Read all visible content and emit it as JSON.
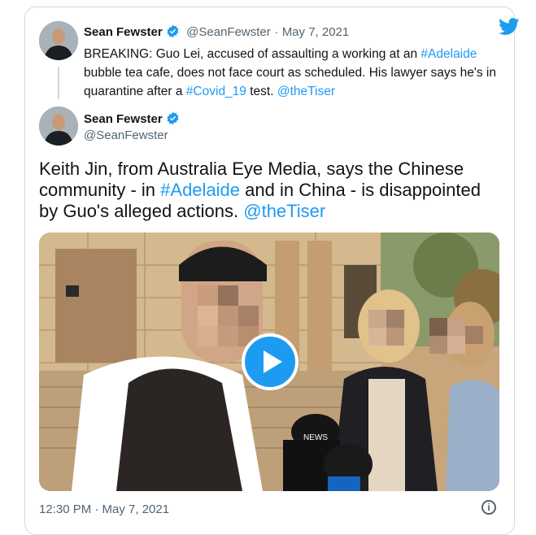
{
  "quoted_tweet": {
    "display_name": "Sean Fewster",
    "handle": "@SeanFewster",
    "separator": "·",
    "date": "May 7, 2021",
    "text_parts": {
      "p1": "BREAKING: Guo Lei, accused of assaulting a working at an ",
      "tag1": "#Adelaide",
      "p2": " bubble tea cafe, does not face court as scheduled. His lawyer says he's in quarantine after a ",
      "tag2": "#Covid_19",
      "p3": " test. ",
      "mention": "@theTiser"
    }
  },
  "main_tweet": {
    "display_name": "Sean Fewster",
    "handle": "@SeanFewster",
    "text_parts": {
      "p1": "Keith Jin, from Australia Eye Media, says the Chinese community - in ",
      "tag1": "#Adelaide",
      "p2": " and in China - is disappointed by Guo's alleged actions. ",
      "mention": "@theTiser"
    },
    "timestamp": "12:30 PM · May 7, 2021",
    "info_glyph": "i",
    "microphone_label": "NEWS"
  },
  "icons": {
    "brand": "twitter-bird-icon",
    "verified": "verified-badge-icon",
    "play": "play-icon",
    "info": "info-icon"
  },
  "colors": {
    "accent": "#1d9bf0",
    "text": "#0f1419",
    "muted": "#536471",
    "border": "#cfd9de"
  }
}
